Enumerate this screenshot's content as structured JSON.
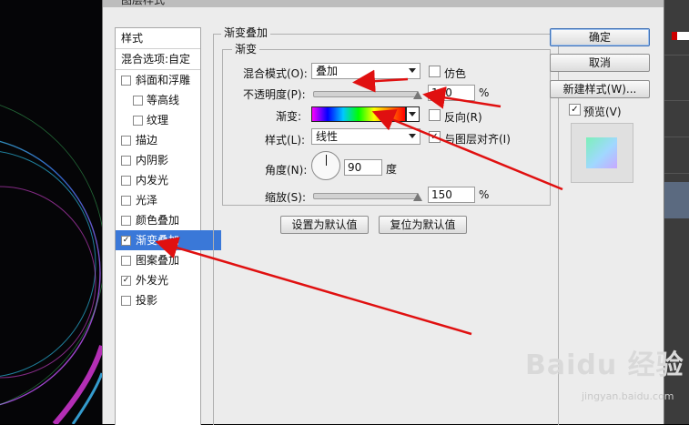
{
  "dialog": {
    "title": "图层样式"
  },
  "style_list": {
    "header": "样式",
    "blend_options": "混合选项:自定",
    "items": [
      {
        "label": "斜面和浮雕",
        "checked": false,
        "indent": false
      },
      {
        "label": "等高线",
        "checked": false,
        "indent": true
      },
      {
        "label": "纹理",
        "checked": false,
        "indent": true
      },
      {
        "label": "描边",
        "checked": false,
        "indent": false
      },
      {
        "label": "内阴影",
        "checked": false,
        "indent": false
      },
      {
        "label": "内发光",
        "checked": false,
        "indent": false
      },
      {
        "label": "光泽",
        "checked": false,
        "indent": false
      },
      {
        "label": "颜色叠加",
        "checked": false,
        "indent": false
      },
      {
        "label": "渐变叠加",
        "checked": true,
        "indent": false,
        "selected": true
      },
      {
        "label": "图案叠加",
        "checked": false,
        "indent": false
      },
      {
        "label": "外发光",
        "checked": true,
        "indent": false
      },
      {
        "label": "投影",
        "checked": false,
        "indent": false
      }
    ]
  },
  "gradient_overlay": {
    "section_title": "渐变叠加",
    "group_title": "渐变",
    "blend_mode_label": "混合模式(O):",
    "blend_mode_value": "叠加",
    "dither_label": "仿色",
    "dither_checked": false,
    "opacity_label": "不透明度(P):",
    "opacity_value": "100",
    "opacity_percent": 100,
    "opacity_unit": "%",
    "gradient_label": "渐变:",
    "gradient_colors": [
      "#ff00ff",
      "#0000ff",
      "#00c8ff",
      "#00ff00",
      "#ffff00",
      "#ff8000",
      "#ff0000"
    ],
    "reverse_label": "反向(R)",
    "reverse_checked": false,
    "style_label": "样式(L):",
    "style_value": "线性",
    "align_label": "与图层对齐(I)",
    "align_checked": true,
    "angle_label": "角度(N):",
    "angle_value": "90",
    "angle_unit": "度",
    "scale_label": "缩放(S):",
    "scale_value": "150",
    "scale_percent": 150,
    "scale_unit": "%",
    "set_default_button": "设置为默认值",
    "reset_default_button": "复位为默认值"
  },
  "side_buttons": {
    "ok": "确定",
    "cancel": "取消",
    "new_style": "新建样式(W)...",
    "preview_label": "预览(V)",
    "preview_checked": true
  },
  "watermark": {
    "brand": "Baidu 经验",
    "url": "jingyan.baidu.com"
  },
  "colors": {
    "selection": "#3a78d8",
    "annotation_arrow": "#e01010"
  }
}
